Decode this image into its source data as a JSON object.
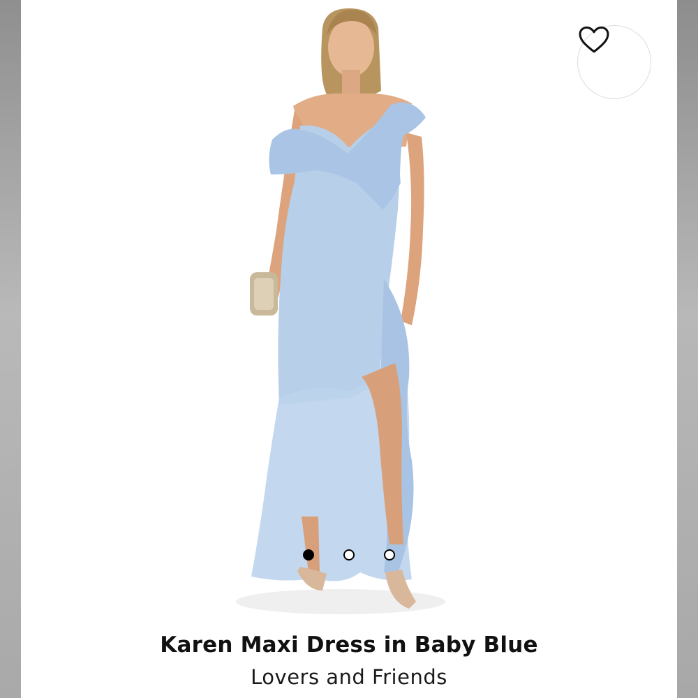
{
  "product": {
    "title": "Karen Maxi Dress in Baby Blue",
    "brand": "Lovers and Friends"
  },
  "gallery": {
    "image_count": 3,
    "active_index": 0
  },
  "icons": {
    "wishlist": "heart-outline-icon"
  },
  "colors": {
    "dress": "#b7cfe9",
    "background": "#ffffff",
    "side_frame": "#a9a9a9",
    "text": "#111111"
  }
}
